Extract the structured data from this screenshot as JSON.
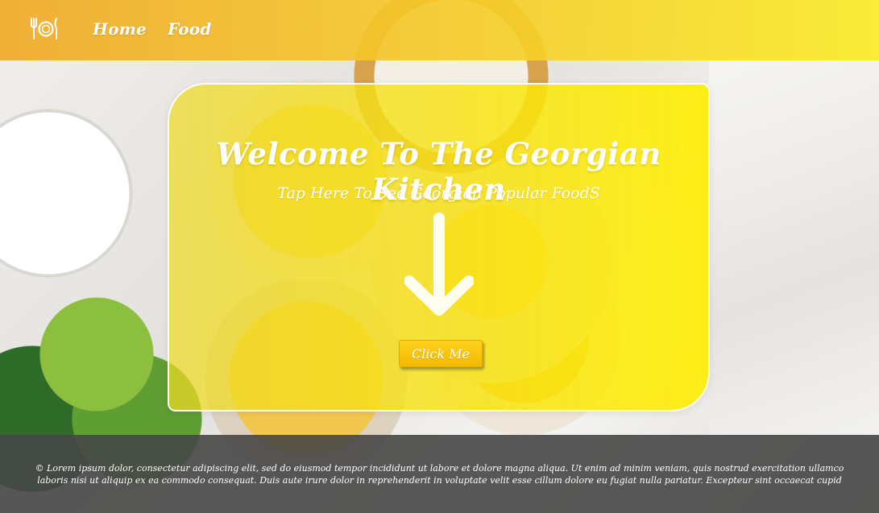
{
  "header": {
    "logo_icon": "plate-cutlery-icon",
    "nav": [
      {
        "label": "Home"
      },
      {
        "label": "Food"
      }
    ]
  },
  "hero": {
    "title": "Welcome To The Georgian Kitchen",
    "subtitle": "Tap Here To See Georgian Popular FoodS",
    "arrow_icon": "arrow-down-icon",
    "button_label": "Click Me"
  },
  "footer": {
    "text": "© Lorem ipsum dolor, consectetur adipiscing elit, sed do eiusmod tempor incididunt ut labore et dolore magna aliqua. Ut enim ad minim veniam, quis nostrud exercitation ullamco laboris nisi ut aliquip ex ea commodo consequat. Duis aute irure dolor in reprehenderit in voluptate velit esse cillum dolore eu fugiat nulla pariatur. Excepteur sint occaecat cupid"
  },
  "colors": {
    "header_start": "#f0aa28",
    "header_end": "#faeb28",
    "hero_yellow": "#ffee00",
    "button": "#f5b800",
    "footer_bg": "#464646"
  }
}
